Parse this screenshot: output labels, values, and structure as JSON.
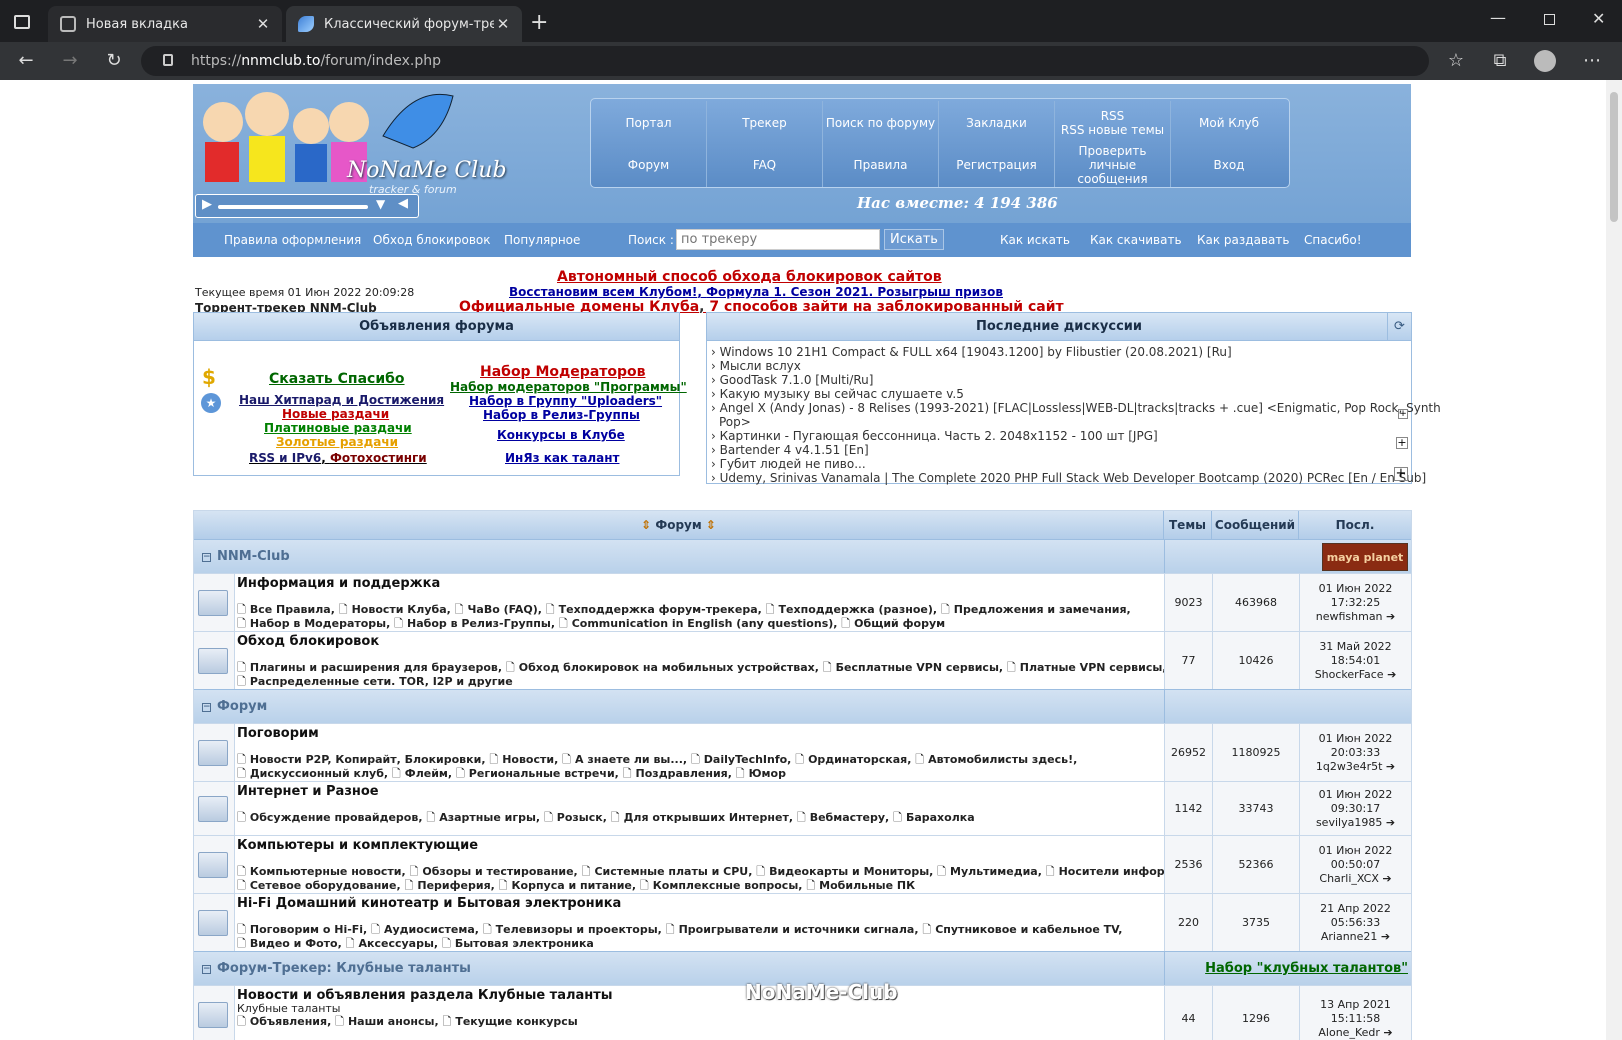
{
  "browser": {
    "tabs": [
      {
        "label": "Новая вкладка",
        "active": false
      },
      {
        "label": "Классический форум-трекер :: ",
        "active": true
      }
    ],
    "url_scheme": "https://",
    "url_host": "nnmclub.to",
    "url_path": "/forum/index.php"
  },
  "header": {
    "logo_title": "NoNaMe Club",
    "logo_subtitle": "tracker & forum",
    "slogan": "Нас вместе: 4 194 386",
    "nav_row1": [
      "Портал",
      "Трекер",
      "Поиск по форуму",
      "Закладки",
      "RSS\nRSS новые темы",
      "Мой Клуб"
    ],
    "nav_row2": [
      "Форум",
      "FAQ",
      "Правила",
      "Регистрация",
      "Проверить личные сообщения",
      "Вход"
    ],
    "search": {
      "links_left": [
        "Правила оформления",
        "Обход блокировок",
        "Популярное"
      ],
      "label": "Поиск :",
      "placeholder": "по трекеру",
      "button": "Искать",
      "links_right": [
        "Как искать",
        "Как скачивать",
        "Как раздавать",
        "Спасибо!"
      ]
    }
  },
  "status": {
    "time": "Текущее время 01 Июн 2022 20:09:28",
    "site": "Торрент-трекер NNM-Club"
  },
  "promo": {
    "line1": "Автономный способ обхода блокировок сайтов",
    "line2a": "Восстановим всем Клубом!",
    "line2b": "Формула 1. Сезон 2021. Розыгрыш призов",
    "line3a": "Официальные домены Клуба",
    "line3b": "7 способов зайти на заблокированный сайт"
  },
  "announcements": {
    "title": "Объявления форума",
    "links": {
      "thanks": "Сказать Спасибо",
      "hitparade": "Наш Хитпарад и Достижения",
      "new": "Новые раздачи",
      "platinum": "Платиновые раздачи",
      "gold": "Золотые раздачи",
      "rss": "RSS и IPv6",
      "photo": "Фотохостинги",
      "moderators": "Набор Модераторов",
      "mod_programs": "Набор модераторов \"Программы\"",
      "uploaders": "Набор в Группу \"Uploaders\"",
      "release": "Набор в Релиз-Группы",
      "contests": "Конкурсы в Клубе",
      "inyaz": "ИнЯз как талант"
    }
  },
  "discussions": {
    "title": "Последние дискуссии",
    "items": [
      "Windows 10 21H1 Compact & FULL x64 [19043.1200] by Flibustier (20.08.2021) [Ru]",
      "Мысли вслух",
      "GoodTask 7.1.0 [Multi/Ru]",
      "Какую музыку вы сейчас слушаете v.5",
      "Angel X (Andy Jonas) - 8 Relises (1993-2021) [FLAC|Lossless|WEB-DL|tracks|tracks + .cue] <Enigmatic, Pop Rock, Synth",
      "Pop>",
      "Картинки - Пугающая бессонница. Часть 2. 2048x1152 - 100 шт [JPG]",
      "Bartender 4 v4.1.51 [En]",
      "Губит людей не пиво...",
      "Udemy, Srinivas Vanamala | The Complete 2020 PHP Full Stack Web Developer Bootcamp (2020) PCRec [En / En Sub]"
    ]
  },
  "forum_table": {
    "headers": [
      "Форум",
      "Темы",
      "Сообщений",
      "Посл. сообщение"
    ],
    "categories": [
      {
        "title": "NNM-Club",
        "right": "maya planet"
      },
      {
        "title": "Форум",
        "right": ""
      },
      {
        "title": "Форум-Трекер: Клубные таланты",
        "right": "Набор \"клубных талантов\""
      }
    ],
    "rows": [
      {
        "title": "Информация и поддержка",
        "sub1": [
          "Все Правила,",
          "Новости Клуба,",
          "ЧаВо (FAQ),",
          "Техподдержка форум-трекера,",
          "Техподдержка (разное),",
          "Предложения и замечания,"
        ],
        "sub2": [
          "Набор в Модераторы,",
          "Набор в Релиз-Группы,",
          "Communication in English (any questions),",
          "Общий форум"
        ],
        "topics": "9023",
        "posts": "463968",
        "last_date": "01 Июн 2022 17:32:25",
        "last_user": "newfishman"
      },
      {
        "title": "Обход блокировок",
        "sub1": [
          "Плагины и расширения для браузеров,",
          "Обход блокировок на мобильных устройствах,",
          "Бесплатные VPN сервисы,",
          "Платные VPN сервисы,"
        ],
        "sub2": [
          "Распределенные сети. TOR, I2P и другие"
        ],
        "topics": "77",
        "posts": "10426",
        "last_date": "31 Май 2022 18:54:01",
        "last_user": "ShockerFace"
      },
      {
        "title": "Поговорим",
        "sub1": [
          "Новости P2P, Копирайт, Блокировки,",
          "Новости,",
          "А знаете ли вы...,",
          "DailyTechInfo,",
          "Ординаторская,",
          "Автомобилисты здесь!,"
        ],
        "sub2": [
          "Дискуссионный клуб,",
          "Флейм,",
          "Региональные встречи,",
          "Поздравления,",
          "Юмор"
        ],
        "topics": "26952",
        "posts": "1180925",
        "last_date": "01 Июн 2022 20:03:33",
        "last_user": "1q2w3e4r5t"
      },
      {
        "title": "Интернет и Разное",
        "sub1": [
          "Обсуждение провайдеров,",
          "Азартные игры,",
          "Розыск,",
          "Для открывших Интернет,",
          "Вебмастеру,",
          "Барахолка"
        ],
        "sub2": [],
        "topics": "1142",
        "posts": "33743",
        "last_date": "01 Июн 2022 09:30:17",
        "last_user": "sevilya1985"
      },
      {
        "title": "Компьютеры и комплектующие",
        "sub1": [
          "Компьютерные новости,",
          "Обзоры и тестирование,",
          "Системные платы и CPU,",
          "Видеокарты и Мониторы,",
          "Мультимедиа,",
          "Носители информации,"
        ],
        "sub2": [
          "Сетевое оборудование,",
          "Периферия,",
          "Корпуса и питание,",
          "Комплексные вопросы,",
          "Мобильные ПК"
        ],
        "topics": "2536",
        "posts": "52366",
        "last_date": "01 Июн 2022 00:50:07",
        "last_user": "Charli_XCX"
      },
      {
        "title": "Hi-Fi Домашний кинотеатр и Бытовая электроника",
        "sub1": [
          "Поговорим о Hi-Fi,",
          "Аудиосистема,",
          "Телевизоры и проекторы,",
          "Проигрыватели и источники сигнала,",
          "Спутниковое и кабельное TV,"
        ],
        "sub2": [
          "Видео и Фото,",
          "Аксессуары,",
          "Бытовая электроника"
        ],
        "topics": "220",
        "posts": "3735",
        "last_date": "21 Апр 2022 05:56:33",
        "last_user": "Arianne21"
      },
      {
        "title": "Новости и объявления раздела Клубные таланты",
        "note": "Клубные таланты",
        "sub1": [
          "Объявления,",
          "Наши анонсы,",
          "Текущие конкурсы"
        ],
        "sub2": [],
        "topics": "44",
        "posts": "1296",
        "last_date": "13 Апр 2021 15:11:58",
        "last_user": "Alone_Kedr"
      }
    ]
  },
  "watermark": "NoNaMe-Club",
  "colors": {
    "header_blue": "#6f9fd2",
    "table_head": "#b3cde9",
    "link_red": "#c00000",
    "link_green": "#006600",
    "link_gold": "#e6a000",
    "link_navy": "#000080"
  }
}
